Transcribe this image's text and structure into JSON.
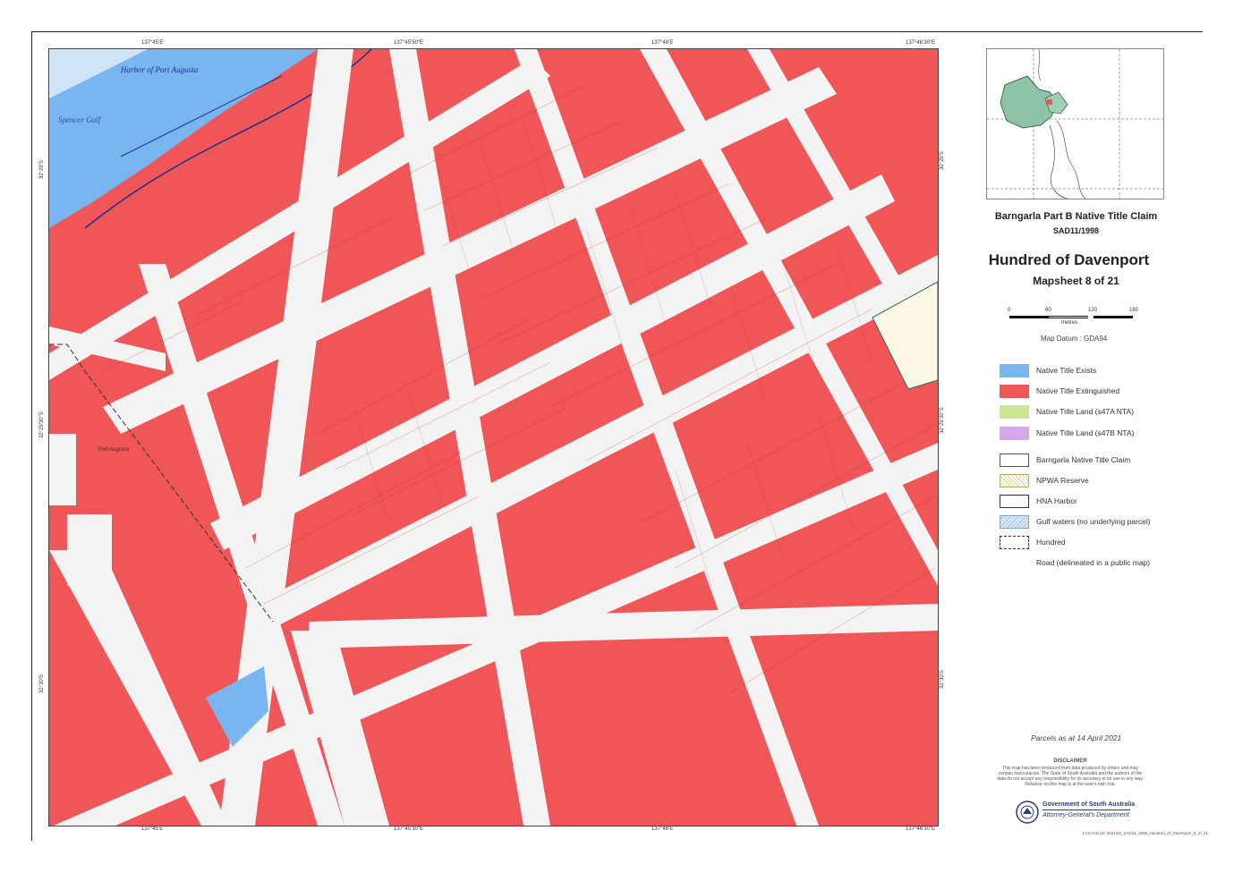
{
  "map": {
    "top_coords": [
      "137°45'E",
      "137°45'30\"E",
      "137°46'E",
      "137°46'30\"E"
    ],
    "bottom_coords": [
      "137°45'E",
      "137°45'30\"E",
      "137°46'E",
      "137°46'30\"E"
    ],
    "left_coords": [
      "32°29'S",
      "32°29'30\"S",
      "32°30'S"
    ],
    "right_coords": [
      "32°29'S",
      "32°29'30\"S",
      "32°30'S"
    ],
    "place_labels": {
      "harbor": "Harbor of Port Augusta",
      "gulf": "Spencer Gulf",
      "port": "Port Augusta"
    },
    "colors": {
      "extinguished": "#f05658",
      "exists": "#79b6f0",
      "road": "#f3f3f3"
    }
  },
  "panel": {
    "claim_title": "Barngarla Part B Native Title Claim",
    "claim_number": "SAD11/1998",
    "hundred_title": "Hundred of Davenport",
    "mapsheet": "Mapsheet 8 of 21",
    "scale_ticks": [
      "0",
      "60",
      "120",
      "180"
    ],
    "scale_unit": "metres",
    "datum": "Map Datum : GDA94",
    "parcels_date": "Parcels as at 14 April 2021",
    "disclaimer_title": "DISCLAIMER",
    "disclaimer_text": "This map has been produced from data produced by others and may contain inaccuracies. The State of South Australia and the authors of the data do not accept any responsibility for its accuracy or its use in any way. Reliance on this map is at the user's own risk.",
    "gov_line1": "Government of South Australia",
    "gov_line2": "Attorney-General's Department",
    "file_ref": "LCS GIS ref: 2021/02_SAD11_1998_Hundred_of_Davenport_8_of_21"
  },
  "legend": [
    {
      "label": "Native Title Exists",
      "color": "#79b6f0"
    },
    {
      "label": "Native Title Extinguished",
      "color": "#f05658"
    },
    {
      "label": "Native Title Land (s47A NTA)",
      "color": "#c9e88f"
    },
    {
      "label": "Native Title Land (s47B NTA)",
      "color": "#d6a8e8"
    },
    {
      "label": "Barngarla Native Title Claim",
      "color": "#2f6f4f"
    },
    {
      "label": "NPWA Reserve",
      "color": "#b6b24f"
    },
    {
      "label": "HNA Harbor",
      "color": "#1a2f8f"
    },
    {
      "label": "Gulf waters (no underlying parcel)",
      "color": "#9cc4e8"
    },
    {
      "label": "Hundred",
      "color": "#333333"
    },
    {
      "label": "Road (delineated in a public map)",
      "color": "#ffffff"
    }
  ]
}
